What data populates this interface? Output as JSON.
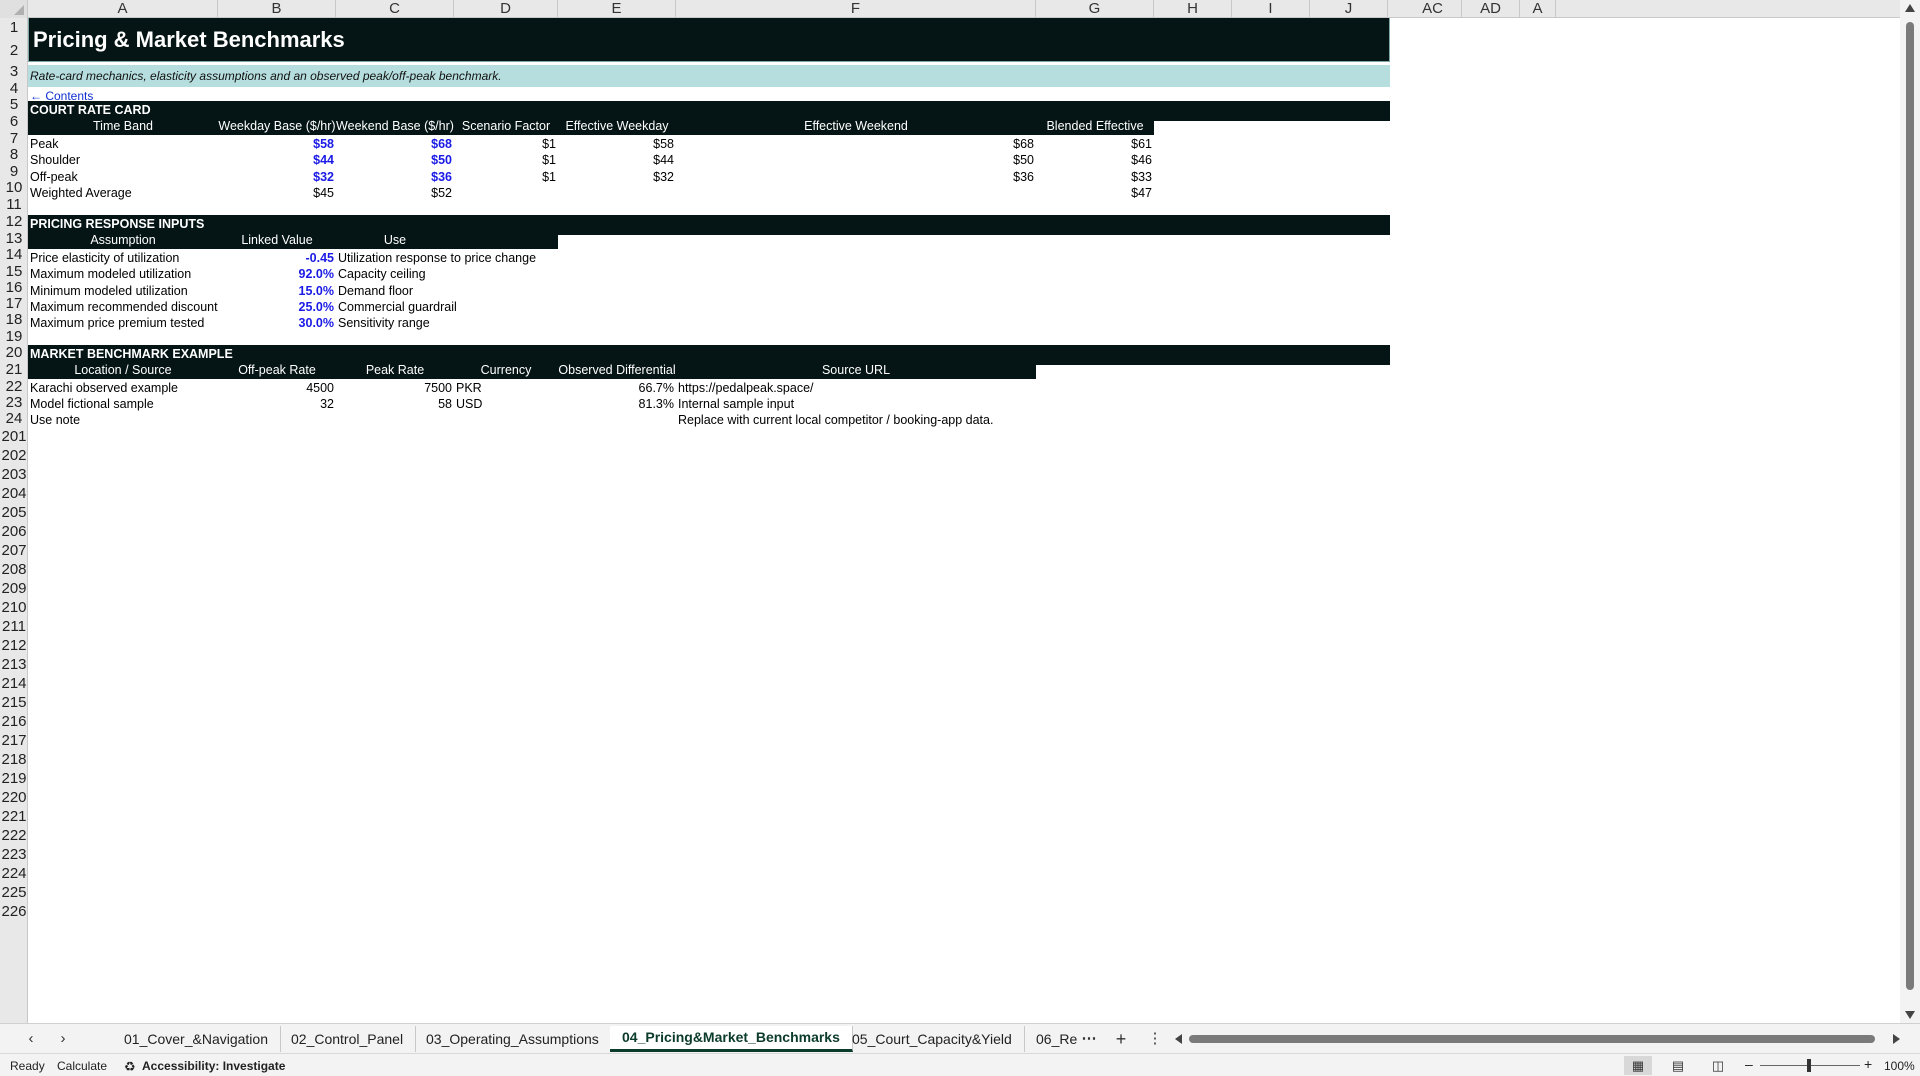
{
  "columns": [
    "A",
    "B",
    "C",
    "D",
    "E",
    "F",
    "G",
    "H",
    "I",
    "J",
    "AC",
    "AD",
    "A"
  ],
  "rows": [
    "1",
    "2",
    "3",
    "4",
    "5",
    "6",
    "7",
    "8",
    "9",
    "10",
    "11",
    "12",
    "13",
    "14",
    "15",
    "16",
    "17",
    "18",
    "19",
    "20",
    "21",
    "22",
    "23",
    "24",
    "201",
    "202",
    "203",
    "204",
    "205",
    "206",
    "207",
    "208",
    "209",
    "210",
    "211",
    "212",
    "213",
    "214",
    "215",
    "216",
    "217",
    "218",
    "219",
    "220",
    "221",
    "222",
    "223",
    "224",
    "225",
    "226"
  ],
  "title": "Pricing & Market Benchmarks",
  "subtitle": "Rate-card mechanics, elasticity assumptions and an observed peak/off-peak benchmark.",
  "contents_link": "← Contents",
  "rate_card": {
    "section": "COURT RATE CARD",
    "headers": [
      "Time Band",
      "Weekday Base ($/hr)",
      "Weekend Base ($/hr)",
      "Scenario Factor",
      "Effective Weekday",
      "Effective Weekend",
      "Blended Effective"
    ],
    "rows": [
      {
        "band": "Peak",
        "weekday": "$58",
        "weekend": "$68",
        "factor": "$1",
        "eff_weekday": "$58",
        "eff_weekend": "$68",
        "blended": "$61"
      },
      {
        "band": "Shoulder",
        "weekday": "$44",
        "weekend": "$50",
        "factor": "$1",
        "eff_weekday": "$44",
        "eff_weekend": "$50",
        "blended": "$46"
      },
      {
        "band": "Off-peak",
        "weekday": "$32",
        "weekend": "$36",
        "factor": "$1",
        "eff_weekday": "$32",
        "eff_weekend": "$36",
        "blended": "$33"
      },
      {
        "band": "Weighted Average",
        "weekday": "$45",
        "weekend": "$52",
        "factor": "",
        "eff_weekday": "",
        "eff_weekend": "",
        "blended": "$47"
      }
    ]
  },
  "pricing_inputs": {
    "section": "PRICING RESPONSE INPUTS",
    "headers": [
      "Assumption",
      "Linked Value",
      "Use"
    ],
    "rows": [
      {
        "assumption": "Price elasticity of utilization",
        "value": "-0.45",
        "use": "Utilization response to price change"
      },
      {
        "assumption": "Maximum modeled utilization",
        "value": "92.0%",
        "use": "Capacity ceiling"
      },
      {
        "assumption": "Minimum modeled utilization",
        "value": "15.0%",
        "use": "Demand floor"
      },
      {
        "assumption": "Maximum recommended discount",
        "value": "25.0%",
        "use": "Commercial guardrail"
      },
      {
        "assumption": "Maximum price premium tested",
        "value": "30.0%",
        "use": "Sensitivity range"
      }
    ]
  },
  "benchmark": {
    "section": "MARKET BENCHMARK EXAMPLE",
    "headers": [
      "Location / Source",
      "Off-peak Rate",
      "Peak Rate",
      "Currency",
      "Observed Differential",
      "Source URL"
    ],
    "rows": [
      {
        "location": "Karachi observed example",
        "offpeak": "4500",
        "peak": "7500",
        "currency": "PKR",
        "diff": "66.7%",
        "url": "https://pedalpeak.space/"
      },
      {
        "location": "Model fictional sample",
        "offpeak": "32",
        "peak": "58",
        "currency": "USD",
        "diff": "81.3%",
        "url": "Internal sample input"
      },
      {
        "location": "Use note",
        "offpeak": "",
        "peak": "",
        "currency": "",
        "diff": "",
        "url": "Replace with current local competitor / booking-app data."
      }
    ]
  },
  "tabs": [
    "01_Cover_&Navigation",
    "02_Control_Panel",
    "03_Operating_Assumptions",
    "04_Pricing&Market_Benchmarks",
    "05_Court_Capacity&Yield",
    "06_Re"
  ],
  "active_tab": "04_Pricing&Market_Benchmarks",
  "status": {
    "ready": "Ready",
    "calculate": "Calculate",
    "accessibility": "Accessibility: Investigate",
    "zoom": "100%"
  },
  "colors": {
    "dark_band": "#051414",
    "subtitle_band": "#b7dede",
    "input_blue": "#1a1ae6"
  }
}
